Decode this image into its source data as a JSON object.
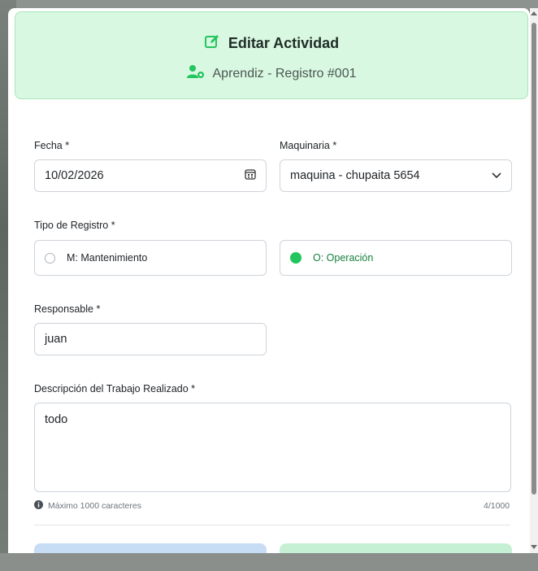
{
  "modal": {
    "title": "Editar Actividad",
    "subtitle": "Aprendiz - Registro #001",
    "title_icon": "edit-icon",
    "subtitle_icon": "user-gear-icon",
    "accent_color": "#22c55e"
  },
  "form": {
    "fecha": {
      "label": "Fecha *",
      "value": "10/02/2026",
      "icon": "calendar-icon"
    },
    "maquinaria": {
      "label": "Maquinaria *",
      "value": "maquina - chupaita 5654",
      "icon": "chevron-down-icon"
    },
    "tipo_registro": {
      "label": "Tipo de Registro *",
      "options": [
        {
          "label": "M: Mantenimiento",
          "checked": false
        },
        {
          "label": "O: Operación",
          "checked": true
        }
      ]
    },
    "responsable": {
      "label": "Responsable *",
      "value": "juan"
    },
    "descripcion": {
      "label": "Descripción del Trabajo Realizado *",
      "value": "todo",
      "hint": "Máximo 1000 caracteres",
      "hint_icon": "info-icon",
      "counter": "4/1000"
    }
  }
}
